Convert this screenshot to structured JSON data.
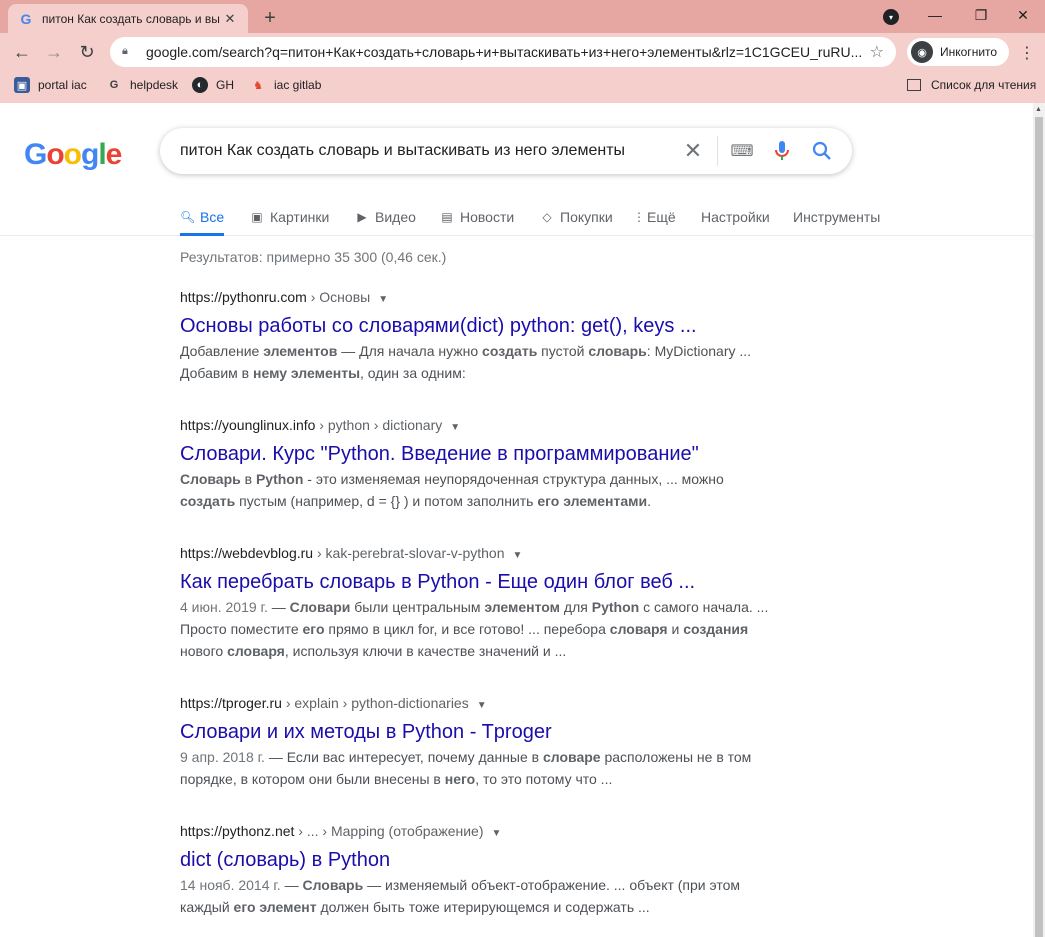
{
  "browser": {
    "tab_title": "питон Как создать словарь и вы",
    "url": "google.com/search?q=питон+Как+создать+словарь+и+вытаскивать+из+него+элементы&rlz=1C1GCEU_ruRU...",
    "incognito_label": "Инкогнито",
    "bookmarks": [
      {
        "label": "portal iac",
        "icon": "portal-icon"
      },
      {
        "label": "helpdesk",
        "icon": "google-icon"
      },
      {
        "label": "GH",
        "icon": "github-icon"
      },
      {
        "label": "iac gitlab",
        "icon": "gitlab-icon"
      }
    ],
    "reading_list_label": "Список для чтения"
  },
  "search": {
    "logo": "Google",
    "query": "питон Как создать словарь и вытаскивать из него элементы",
    "tabs": [
      {
        "label": "Все",
        "icon": "search-icon"
      },
      {
        "label": "Картинки",
        "icon": "image-icon"
      },
      {
        "label": "Видео",
        "icon": "video-icon"
      },
      {
        "label": "Новости",
        "icon": "news-icon"
      },
      {
        "label": "Покупки",
        "icon": "tag-icon"
      },
      {
        "label": "Ещё",
        "icon": "more-icon"
      },
      {
        "label": "Настройки"
      },
      {
        "label": "Инструменты"
      }
    ],
    "stats": "Результатов: примерно 35 300 (0,46 сек.)"
  },
  "results": [
    {
      "domain": "https://pythonru.com",
      "path": " › Основы",
      "title": "Основы работы со словарями(dict) python: get(), keys ...",
      "snippet": [
        [
          [
            "",
            "Добавление "
          ],
          [
            "b",
            "элементов"
          ],
          [
            "",
            " — Для начала нужно "
          ],
          [
            "b",
            "создать"
          ],
          [
            "",
            " пустой "
          ],
          [
            "b",
            "словарь"
          ],
          [
            "",
            ": MyDictionary ..."
          ]
        ],
        [
          [
            "",
            "Добавим в "
          ],
          [
            "b",
            "нему"
          ],
          [
            "",
            " "
          ],
          [
            "b",
            "элементы"
          ],
          [
            "",
            ", один за одним:"
          ]
        ]
      ]
    },
    {
      "domain": "https://younglinux.info",
      "path": " › python › dictionary",
      "title": "Словари. Курс \"Python. Введение в программирование\"",
      "snippet": [
        [
          [
            "b",
            "Словарь"
          ],
          [
            "",
            " в "
          ],
          [
            "b",
            "Python"
          ],
          [
            "",
            " - это изменяемая неупорядоченная структура данных, ... можно"
          ]
        ],
        [
          [
            "b",
            "создать"
          ],
          [
            "",
            " пустым (например, d = {} ) и потом заполнить "
          ],
          [
            "b",
            "его элементами"
          ],
          [
            "",
            "."
          ]
        ]
      ]
    },
    {
      "domain": "https://webdevblog.ru",
      "path": " › kak-perebrat-slovar-v-python",
      "title": "Как перебрать словарь в Python - Еще один блог веб ...",
      "snippet": [
        [
          [
            "d",
            "4 июн. 2019 г."
          ],
          [
            "",
            " — "
          ],
          [
            "b",
            "Словари"
          ],
          [
            "",
            " были центральным "
          ],
          [
            "b",
            "элементом"
          ],
          [
            "",
            " для "
          ],
          [
            "b",
            "Python"
          ],
          [
            "",
            " с самого начала. ..."
          ]
        ],
        [
          [
            "",
            "Просто поместите "
          ],
          [
            "b",
            "его"
          ],
          [
            "",
            " прямо в цикл for, и все готово! ... перебора "
          ],
          [
            "b",
            "словаря"
          ],
          [
            "",
            " и "
          ],
          [
            "b",
            "создания"
          ]
        ],
        [
          [
            "",
            "нового "
          ],
          [
            "b",
            "словаря"
          ],
          [
            "",
            ", используя ключи в качестве значений и ..."
          ]
        ]
      ]
    },
    {
      "domain": "https://tproger.ru",
      "path": " › explain › python-dictionaries",
      "title": "Словари и их методы в Python - Tproger",
      "snippet": [
        [
          [
            "d",
            "9 апр. 2018 г."
          ],
          [
            "",
            " — Если вас интересует, почему данные в "
          ],
          [
            "b",
            "словаре"
          ],
          [
            "",
            " расположены не в том"
          ]
        ],
        [
          [
            "",
            "порядке, в котором они были внесены в "
          ],
          [
            "b",
            "него"
          ],
          [
            "",
            ", то это потому что ..."
          ]
        ]
      ]
    },
    {
      "domain": "https://pythonz.net",
      "path": " › ... › Mapping (отображение)",
      "title": "dict (словарь) в Python",
      "snippet": [
        [
          [
            "d",
            "14 нояб. 2014 г."
          ],
          [
            "",
            " — "
          ],
          [
            "b",
            "Словарь"
          ],
          [
            "",
            " — изменяемый объект-отображение. ... объект (при этом"
          ]
        ],
        [
          [
            "",
            "каждый "
          ],
          [
            "b",
            "его элемент"
          ],
          [
            "",
            " должен быть тоже итерирующемся и содержать ..."
          ]
        ]
      ]
    }
  ],
  "colors": {
    "link": "#1a0dab",
    "active_tab": "#1a73e8",
    "chrome_bg": "#f5cfcb",
    "tabstrip_bg": "#e6a6a1"
  }
}
